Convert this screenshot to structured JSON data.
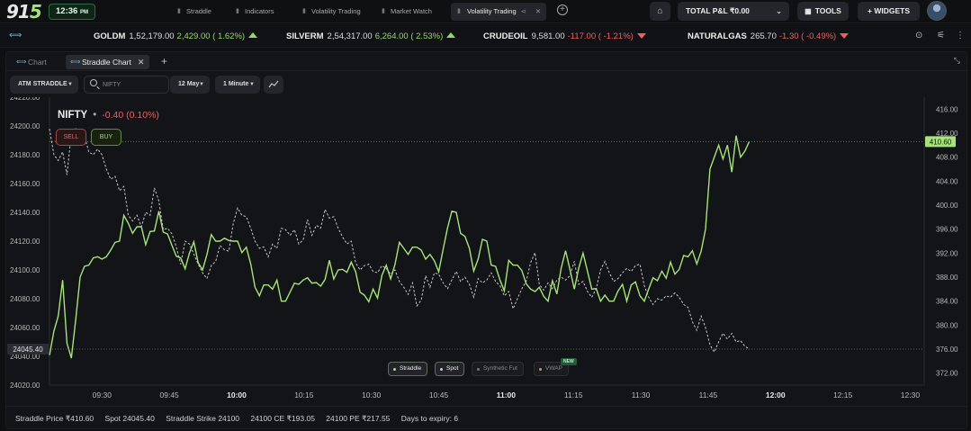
{
  "app": {
    "logo_main": "91",
    "logo_accent": "5",
    "clock": "12:36",
    "clock_suffix": "PM"
  },
  "nav": {
    "tabs": [
      {
        "label": "Straddle"
      },
      {
        "label": "Indicators"
      },
      {
        "label": "Volatility Trading"
      },
      {
        "label": "Market Watch"
      }
    ],
    "active_tab": "Volatility Trading",
    "pnl_label": "TOTAL P&L ₹0.00",
    "tools_label": "TOOLS",
    "widgets_label": "+ WIDGETS"
  },
  "ticker": [
    {
      "symbol": "GOLDM",
      "price": "1,52,179.00",
      "change": "2,429.00 ( 1.62%)",
      "dir": "up"
    },
    {
      "symbol": "SILVERM",
      "price": "2,54,317.00",
      "change": "6,264.00 ( 2.53%)",
      "dir": "up"
    },
    {
      "symbol": "CRUDEOIL",
      "price": "9,581.00",
      "change": "-117.00 ( -1.21%)",
      "dir": "down"
    },
    {
      "symbol": "NATURALGAS",
      "price": "265.70",
      "change": "-1.30 ( -0.49%)",
      "dir": "down"
    }
  ],
  "panel": {
    "tabs": [
      {
        "label": "Chart"
      },
      {
        "label": "Straddle Chart"
      }
    ],
    "controls": {
      "strategy": "ATM STRADDLE",
      "search_placeholder": "NIFTY",
      "date": "12 May",
      "interval": "1 Minute"
    }
  },
  "header": {
    "symbol": "NIFTY",
    "change": "-0.40 (0.10%)",
    "sell_label": "SELL",
    "buy_label": "BUY"
  },
  "legend": {
    "items": [
      {
        "label": "Straddle",
        "active": true
      },
      {
        "label": "Spot",
        "active": true
      },
      {
        "label": "Synthetic Fut",
        "active": false
      },
      {
        "label": "VWAP",
        "active": false
      }
    ],
    "new_badge": "NEW"
  },
  "status": {
    "straddle_price": "Straddle Price  ₹410.60",
    "spot": "Spot  24045.40",
    "strike": "Straddle Strike  24100",
    "ce": "24100 CE  ₹193.05",
    "pe": "24100 PE  ₹217.55",
    "expiry": "Days to expiry:  6"
  },
  "colors": {
    "straddle": "#a6e37a",
    "spot": "#c8c8c8",
    "negative": "#ef5f5f",
    "positive": "#94d86b"
  },
  "chart_data": {
    "type": "line",
    "x_ticks": [
      "09:30",
      "09:45",
      "10:00",
      "10:15",
      "10:30",
      "10:45",
      "11:00",
      "11:15",
      "11:30",
      "11:45",
      "12:00",
      "12:15",
      "12:30"
    ],
    "left_axis": {
      "ticks": [
        "24220.00",
        "24200.00",
        "24180.00",
        "24160.00",
        "24140.00",
        "24120.00",
        "24100.00",
        "24080.00",
        "24060.00",
        "24040.00",
        "24020.00"
      ],
      "min": 24020,
      "max": 24220
    },
    "right_axis": {
      "ticks": [
        "416.00",
        "412.00",
        "408.00",
        "404.00",
        "400.00",
        "396.00",
        "392.00",
        "388.00",
        "384.00",
        "380.00",
        "376.00",
        "372.00"
      ],
      "min": 370,
      "max": 418
    },
    "spot_last_label": "24045.40",
    "straddle_last_label": "410.60",
    "series": [
      {
        "name": "Straddle",
        "axis": "right",
        "x_min": [
          0,
          5,
          10,
          15,
          20,
          25,
          30,
          35,
          40,
          45,
          50,
          55,
          60,
          65,
          70,
          75,
          80,
          85,
          90,
          95,
          100,
          105,
          110,
          115,
          120,
          125,
          130,
          135,
          140,
          145,
          150,
          155,
          160,
          165,
          170,
          175,
          180,
          185,
          190,
          195,
          200,
          205,
          210,
          215,
          220,
          225,
          230,
          235,
          240,
          245,
          250,
          255,
          260,
          265,
          270,
          275,
          280,
          285,
          290,
          295,
          300,
          305,
          310,
          315,
          320,
          325,
          330,
          335,
          340,
          345,
          350,
          355,
          360,
          365,
          370,
          375,
          380,
          385,
          390,
          395,
          400,
          405,
          410,
          415,
          420,
          425,
          430,
          435,
          440,
          445,
          450,
          455,
          460,
          465,
          470,
          475,
          480,
          485,
          490,
          495,
          500,
          505,
          510,
          515,
          520,
          525,
          530,
          535,
          540,
          545,
          550,
          555,
          560,
          565,
          570,
          575,
          580,
          585,
          590,
          595,
          600,
          605,
          610,
          615,
          620,
          625,
          630,
          635,
          640,
          645,
          650,
          655,
          660,
          665,
          670,
          675,
          680,
          685,
          690,
          695,
          700,
          705,
          710,
          715,
          720,
          725,
          730,
          735,
          740,
          745,
          750,
          755,
          760,
          765,
          770,
          775,
          780,
          785,
          790,
          795,
          800,
          805,
          810,
          815,
          820,
          825,
          830,
          835,
          840,
          845,
          850,
          855,
          860,
          865,
          870,
          875,
          880,
          885,
          890,
          895,
          900,
          905,
          910,
          915,
          920,
          925,
          930,
          935,
          940,
          945,
          950,
          955,
          960,
          965,
          970,
          975,
          980,
          985,
          990,
          995,
          1000
        ],
        "values": [
          375.0,
          379.0,
          381.5,
          387.5,
          377.0,
          374.5,
          381.0,
          388.0,
          389.8,
          390.0,
          391.2,
          391.4,
          391.0,
          391.4,
          392.5,
          393.8,
          394.0,
          398.3,
          397.0,
          395.3,
          396.4,
          396.4,
          393.4,
          395.6,
          395.7,
          399.0,
          395.5,
          395.2,
          393.3,
          391.5,
          391.2,
          389.4,
          392.0,
          393.9,
          390.4,
          389.2,
          391.8,
          395.1,
          394.0,
          394.0,
          394.5,
          394.1,
          394.0,
          394.0,
          392.1,
          393.0,
          390.2,
          386.3,
          384.9,
          386.7,
          386.7,
          386.0,
          387.5,
          384.0,
          384.0,
          385.5,
          387.0,
          386.8,
          387.5,
          387.9,
          387.0,
          387.1,
          386.5,
          387.6,
          390.8,
          387.7,
          389.2,
          389.3,
          388.8,
          390.5,
          388.9,
          385.5,
          385.0,
          383.9,
          386.0,
          384.5,
          388.3,
          390.0,
          387.7,
          390.1,
          393.8,
          392.8,
          391.8,
          393.0,
          393.0,
          392.5,
          391.0,
          391.8,
          390.7,
          388.9,
          392.6,
          396.2,
          399.0,
          398.8,
          395.3,
          394.8,
          392.8,
          389.0,
          391.0,
          394.3,
          394.0,
          390.0,
          389.8,
          387.5,
          385.7,
          390.8,
          390.0,
          390.0,
          389.1,
          386.9,
          386.0,
          385.6,
          386.3,
          384.8,
          384.0,
          387.4,
          385.2,
          389.5,
          392.4,
          389.3,
          386.0,
          389.5,
          392.0,
          389.0,
          386.0,
          386.1,
          384.0,
          385.0,
          384.0,
          384.0,
          385.7,
          386.8,
          384.0,
          386.7,
          387.2,
          384.9,
          384.0,
          386.0,
          387.9,
          387.4,
          389.0,
          387.8,
          390.5,
          388.5,
          389.3,
          391.6,
          391.4,
          392.4,
          390.2,
          392.3,
          396.0,
          406.0,
          408.0,
          410.0,
          407.7,
          410.0,
          405.5,
          411.6,
          408.0,
          409.0,
          410.6
        ]
      },
      {
        "name": "Spot",
        "axis": "left",
        "x_min": [
          0,
          5,
          10,
          15,
          20,
          25,
          30,
          35,
          40,
          45,
          50,
          55,
          60,
          65,
          70,
          75,
          80,
          85,
          90,
          95,
          100,
          105,
          110,
          115,
          120,
          125,
          130,
          135,
          140,
          145,
          150,
          155,
          160,
          165,
          170,
          175,
          180,
          185,
          190,
          195,
          200,
          205,
          210,
          215,
          220,
          225,
          230,
          235,
          240,
          245,
          250,
          255,
          260,
          265,
          270,
          275,
          280,
          285,
          290,
          295,
          300,
          305,
          310,
          315,
          320,
          325,
          330,
          335,
          340,
          345,
          350,
          355,
          360,
          365,
          370,
          375,
          380,
          385,
          390,
          395,
          400,
          405,
          410,
          415,
          420,
          425,
          430,
          435,
          440,
          445,
          450,
          455,
          460,
          465,
          470,
          475,
          480,
          485,
          490,
          495,
          500,
          505,
          510,
          515,
          520,
          525,
          530,
          535,
          540,
          545,
          550,
          555,
          560,
          565,
          570,
          575,
          580,
          585,
          590,
          595,
          600,
          605,
          610,
          615,
          620,
          625,
          630,
          635,
          640,
          645,
          650,
          655,
          660,
          665,
          670,
          675,
          680,
          685,
          690,
          695,
          700,
          705,
          710,
          715,
          720,
          725,
          730,
          735,
          740,
          745,
          750,
          755,
          760,
          765,
          770,
          775,
          780,
          785,
          790,
          795,
          800,
          805,
          810,
          815,
          820,
          825,
          830,
          835,
          840,
          845,
          850,
          855,
          860,
          865,
          870,
          875,
          880,
          885,
          890,
          895,
          900,
          905,
          910,
          915,
          920,
          925,
          930,
          935,
          940,
          945,
          950,
          955,
          960,
          965,
          970,
          975,
          980,
          985,
          990,
          995,
          1000
        ],
        "values": [
          24198,
          24180,
          24176,
          24182,
          24166,
          24195,
          24198,
          24189,
          24193,
          24182,
          24180,
          24184,
          24180,
          24170,
          24163,
          24165,
          24155,
          24158,
          24138,
          24134,
          24138,
          24130,
          24140,
          24138,
          24157,
          24148,
          24128,
          24129,
          24125,
          24116,
          24104,
          24120,
          24118,
          24111,
          24104,
          24098,
          24094,
          24103,
          24106,
          24117,
          24114,
          24113,
          24132,
          24143,
          24138,
          24137,
          24129,
          24120,
          24115,
          24116,
          24109,
          24118,
          24115,
          24129,
          24128,
          24124,
          24128,
          24118,
          24121,
          24135,
          24124,
          24131,
          24129,
          24142,
          24136,
          24137,
          24129,
          24123,
          24118,
          24120,
          24105,
          24100,
          24103,
          24104,
          24099,
          24098,
          24103,
          24101,
          24097,
          24100,
          24092,
          24088,
          24083,
          24091,
          24075,
          24079,
          24096,
          24088,
          24098,
          24097,
          24091,
          24087,
          24093,
          24099,
          24092,
          24095,
          24090,
          24081,
          24094,
          24091,
          24093,
          24098,
          24092,
          24089,
          24082,
          24085,
          24073,
          24080,
          24087,
          24092,
          24105,
          24112,
          24090,
          24086,
          24091,
          24087,
          24093,
          24095,
          24093,
          24096,
          24106,
          24090,
          24092,
          24085,
          24081,
          24087,
          24100,
          24106,
          24098,
          24092,
          24094,
          24098,
          24101,
          24099,
          24103,
          24104,
          24089,
          24081,
          24076,
          24080,
          24079,
          24082,
          24081,
          24084,
          24081,
          24076,
          24074,
          24064,
          24058,
          24068,
          24060,
          24048,
          24043,
          24050,
          24056,
          24052,
          24056,
          24050,
          24051,
          24047,
          24045
        ]
      }
    ]
  }
}
